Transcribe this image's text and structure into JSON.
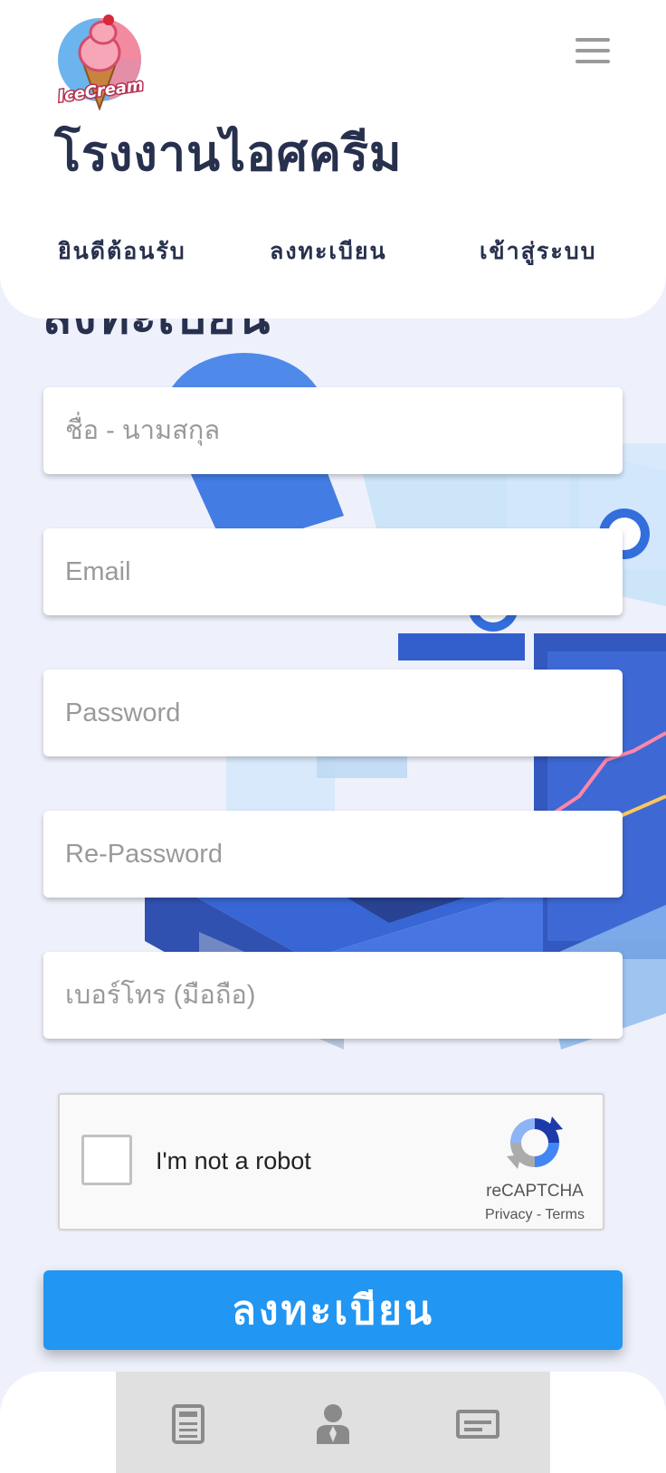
{
  "header": {
    "logo_text": "IceCream",
    "site_title": "โรงงานไอศครีม",
    "nav": [
      {
        "label": "ยินดีต้อนรับ"
      },
      {
        "label": "ลงทะเบียน"
      },
      {
        "label": "เข้าสู่ระบบ"
      }
    ]
  },
  "page": {
    "heading": "ลงทะเบียน"
  },
  "form": {
    "fullname_placeholder": "ชื่อ - นามสกุล",
    "email_placeholder": "Email",
    "password_placeholder": "Password",
    "repassword_placeholder": "Re-Password",
    "phone_placeholder": "เบอร์โทร (มือถือ)",
    "submit_label": "ลงทะเบียน"
  },
  "recaptcha": {
    "label": "I'm not a robot",
    "brand": "reCAPTCHA",
    "privacy": "Privacy",
    "separator": " - ",
    "terms": "Terms"
  },
  "bottom_nav": {
    "icons": [
      "document-icon",
      "user-icon",
      "card-icon"
    ]
  },
  "colors": {
    "primary": "#2196f3",
    "title": "#27304d",
    "background": "#eef1fb"
  }
}
